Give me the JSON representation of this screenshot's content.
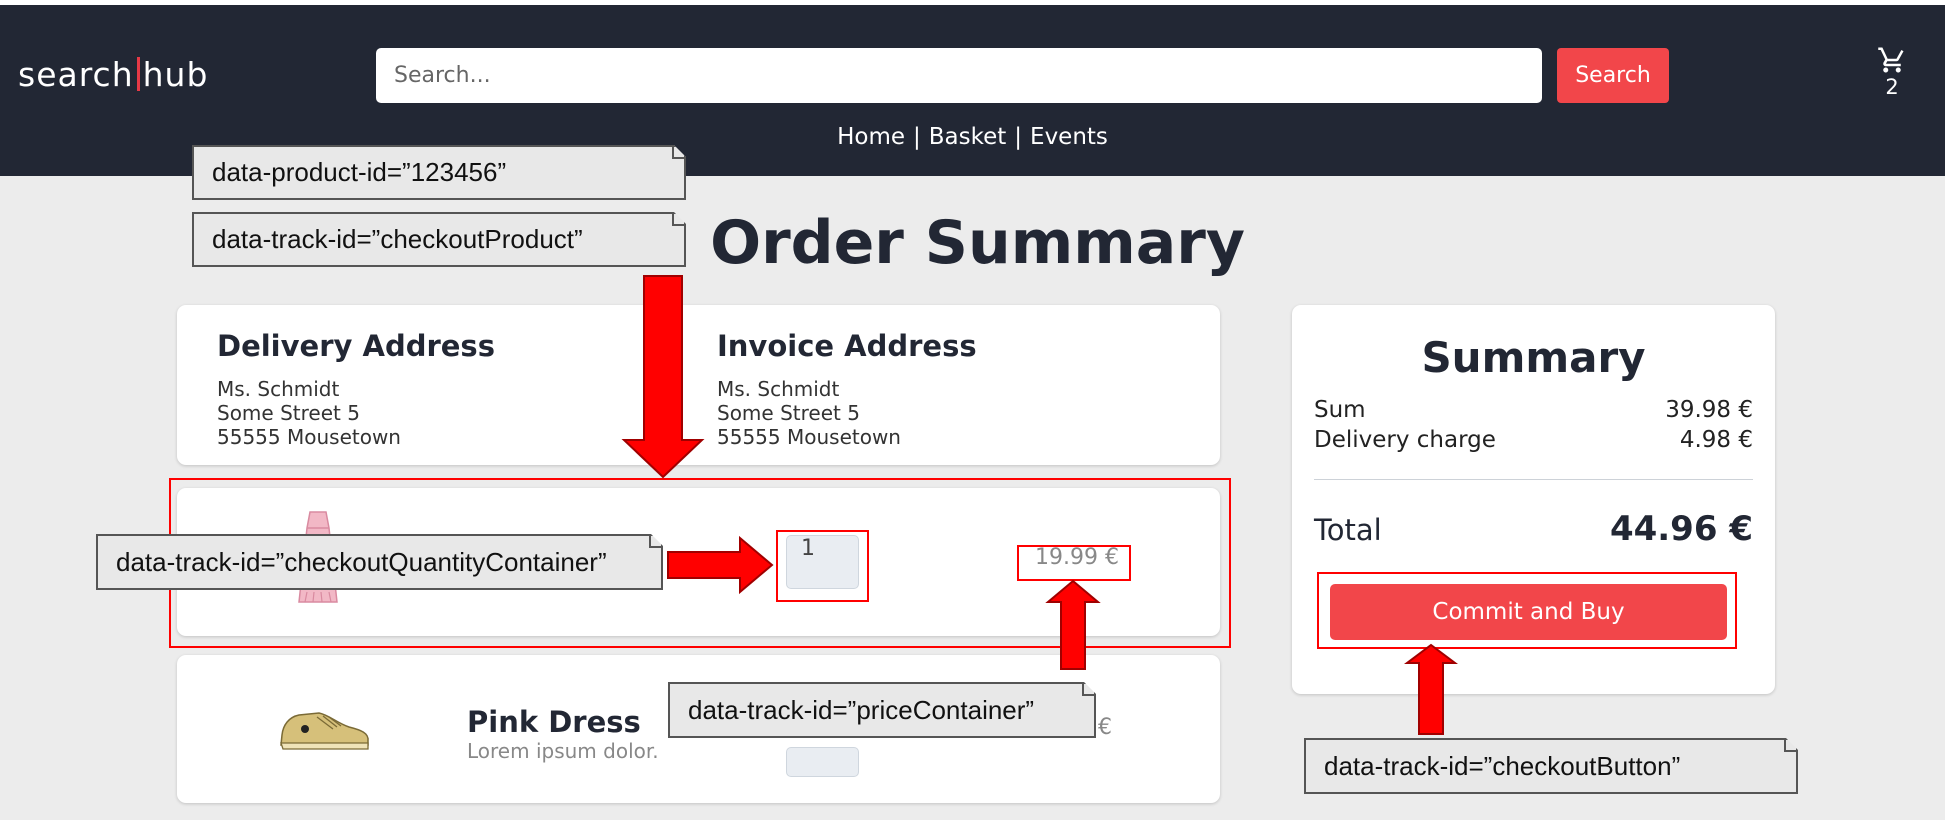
{
  "header": {
    "logo_left": "search",
    "logo_right": "hub",
    "search_placeholder": "Search...",
    "search_button": "Search",
    "cart_count": "2",
    "nav": [
      "Home",
      "Basket",
      "Events"
    ],
    "nav_separator": "|"
  },
  "page_title": "Order Summary",
  "delivery": {
    "title": "Delivery Address",
    "lines": [
      "Ms. Schmidt",
      "Some Street 5",
      "55555 Mousetown"
    ]
  },
  "invoice": {
    "title": "Invoice Address",
    "lines": [
      "Ms. Schmidt",
      "Some Street 5",
      "55555 Mousetown"
    ]
  },
  "items": [
    {
      "image": "pink-dress",
      "quantity": "1",
      "price": "19.99 €"
    },
    {
      "image": "sneaker",
      "name": "Pink Dress",
      "description": "Lorem ipsum dolor.",
      "price_visible": "€"
    }
  ],
  "summary": {
    "title": "Summary",
    "sum_label": "Sum",
    "sum_value": "39.98 €",
    "delivery_label": "Delivery charge",
    "delivery_value": "4.98 €",
    "total_label": "Total",
    "total_value": "44.96 €",
    "buy_button": "Commit and Buy"
  },
  "annotations": {
    "product_id": "data-product-id=”123456”",
    "checkout_product": "data-track-id=”checkoutProduct”",
    "quantity_container": "data-track-id=”checkoutQuantityContainer”",
    "price_container": "data-track-id=”priceContainer”",
    "checkout_button": "data-track-id=”checkoutButton”"
  },
  "colors": {
    "header_bg": "#222734",
    "page_bg": "#ececec",
    "accent": "#f2464a",
    "annotation_red": "#ff0000"
  }
}
